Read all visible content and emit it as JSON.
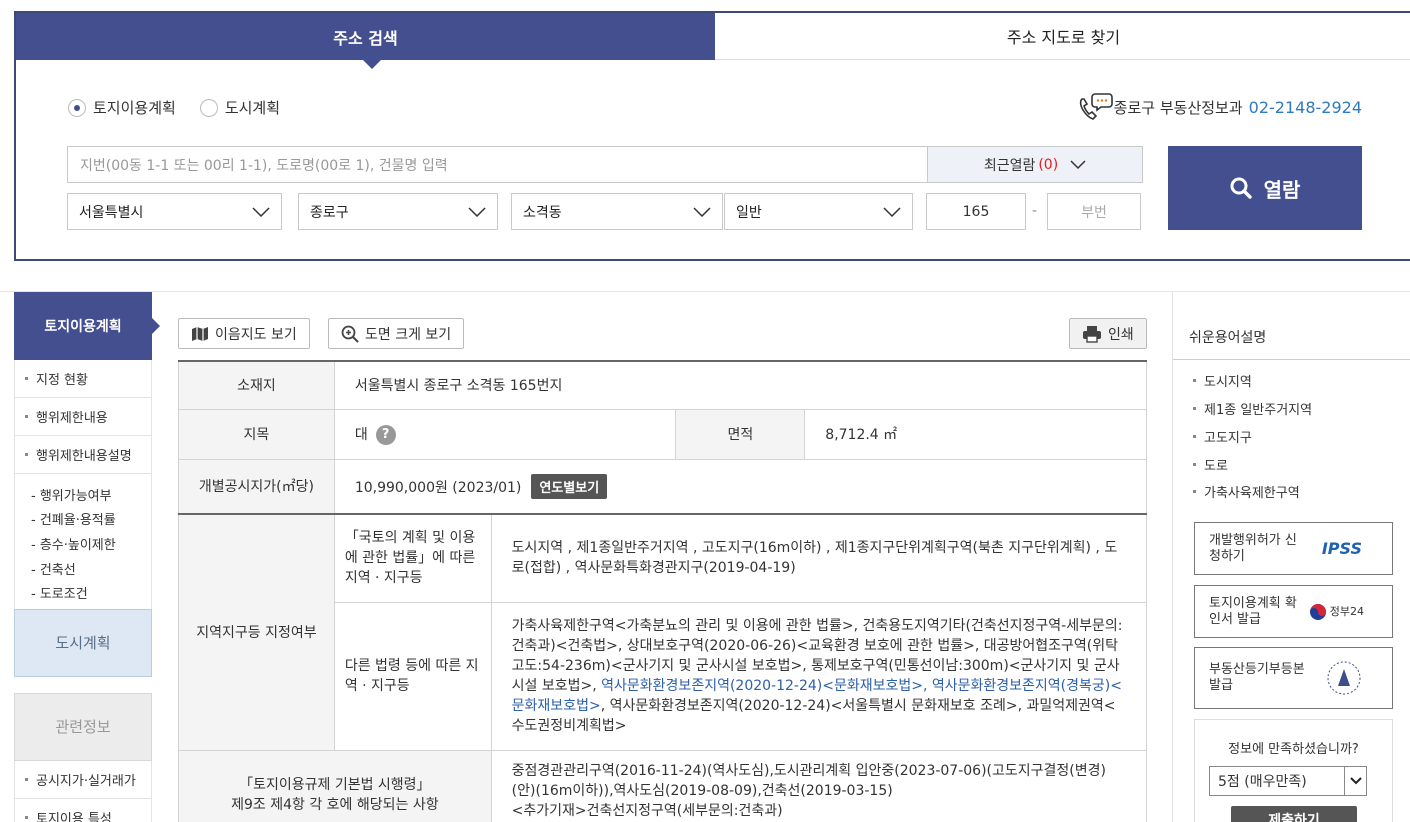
{
  "tabs": {
    "address_search": "주소 검색",
    "map_search": "주소 지도로 찾기"
  },
  "radio": {
    "land_plan": "토지이용계획",
    "city_plan": "도시계획"
  },
  "contact": {
    "label": "종로구 부동산정보과",
    "phone": "02-2148-2924"
  },
  "search": {
    "placeholder": "지번(00동 1-1 또는 00리 1-1), 도로명(00로 1), 건물명 입력",
    "recent_label": "최근열람",
    "recent_count": "(0)",
    "city": "서울특별시",
    "district": "종로구",
    "dong": "소격동",
    "type": "일반",
    "main_no": "165",
    "sub_no_placeholder": "부번",
    "submit": "열람"
  },
  "left_nav": {
    "title": "토지이용계획",
    "items": [
      "지정 현황",
      "행위제한내용",
      "행위제한내용설명"
    ],
    "sub_items": [
      "- 행위가능여부",
      "- 건폐율·용적률",
      "- 층수·높이제한",
      "- 건축선",
      "- 도로조건"
    ],
    "city_plan": "도시계획",
    "related": "관련정보",
    "related_items": [
      "공시지가·실거래가",
      "토지이용 특성"
    ]
  },
  "toolbar": {
    "map_view": "이음지도 보기",
    "zoom_view": "도면 크게 보기",
    "print": "인쇄"
  },
  "info": {
    "location_label": "소재지",
    "location": "서울특별시 종로구 소격동 165번지",
    "jimok_label": "지목",
    "jimok": "대",
    "qmark": "?",
    "area_label": "면적",
    "area": "8,712.4 ㎡",
    "price_label": "개별공시지가(㎡당)",
    "price": "10,990,000원 (2023/01)",
    "price_btn": "연도별보기",
    "zone_label": "지역지구등 지정여부",
    "law1_label": "「국토의 계획 및 이용에 관한 법률」에 따른 지역 · 지구등",
    "law1_value": "도시지역 , 제1종일반주거지역 , 고도지구(16m이하) , 제1종지구단위계획구역(북촌 지구단위계획) , 도로(접합) , 역사문화특화경관지구(2019-04-19)",
    "law2_label": "다른 법령 등에 따른 지역 · 지구등",
    "law2_a": "가축사육제한구역<가축분뇨의 관리 및 이용에 관한 법률>, 건축용도지역기타(건축선지정구역-세부문의:건축과)<건축법>, 상대보호구역(2020-06-26)<교육환경 보호에 관한 법률>, 대공방어협조구역(위탁고도:54-236m)<군사기지 및 군사시설 보호법>, 통제보호구역(민통선이남:300m)<군사기지 및 군사시설 보호법>, ",
    "law2_b": "역사문화환경보존지역(2020-12-24)<문화재보호법>, 역사문화환경보존지역(경복궁)<문화재보호법>",
    "law2_c": ", 역사문화환경보존지역(2020-12-24)<서울특별시 문화재보호 조례>, 과밀억제권역<수도권정비계획법>",
    "reg_label_1": "「토지이용규제 기본법 시행령」",
    "reg_label_2": "제9조 제4항 각 호에 해당되는 사항",
    "reg_value": "중점경관관리구역(2016-11-24)(역사도심),도시관리계획 입안중(2023-07-06)(고도지구결정(변경)(안)(16m이하)),역사도심(2019-08-09),건축선(2019-03-15)",
    "reg_value_2": "<추가기재>건축선지정구역(세부문의:건축과)"
  },
  "right": {
    "title": "쉬운용어설명",
    "terms": [
      "도시지역",
      "제1종 일반주거지역",
      "고도지구",
      "도로",
      "가축사육제한구역"
    ],
    "svc1": "개발행위허가 신청하기",
    "svc1_logo": "IPSS",
    "svc2": "토지이용계획 확인서 발급",
    "svc2_logo": "정부24",
    "svc3": "부동산등기부등본 발급",
    "survey_q": "정보에 만족하셨습니까?",
    "survey_opt": "5점 (매우만족)",
    "survey_btn": "제출하기"
  },
  "colors": {
    "primary": "#434f8f",
    "link": "#2d7ac0",
    "alert": "#e02020"
  }
}
